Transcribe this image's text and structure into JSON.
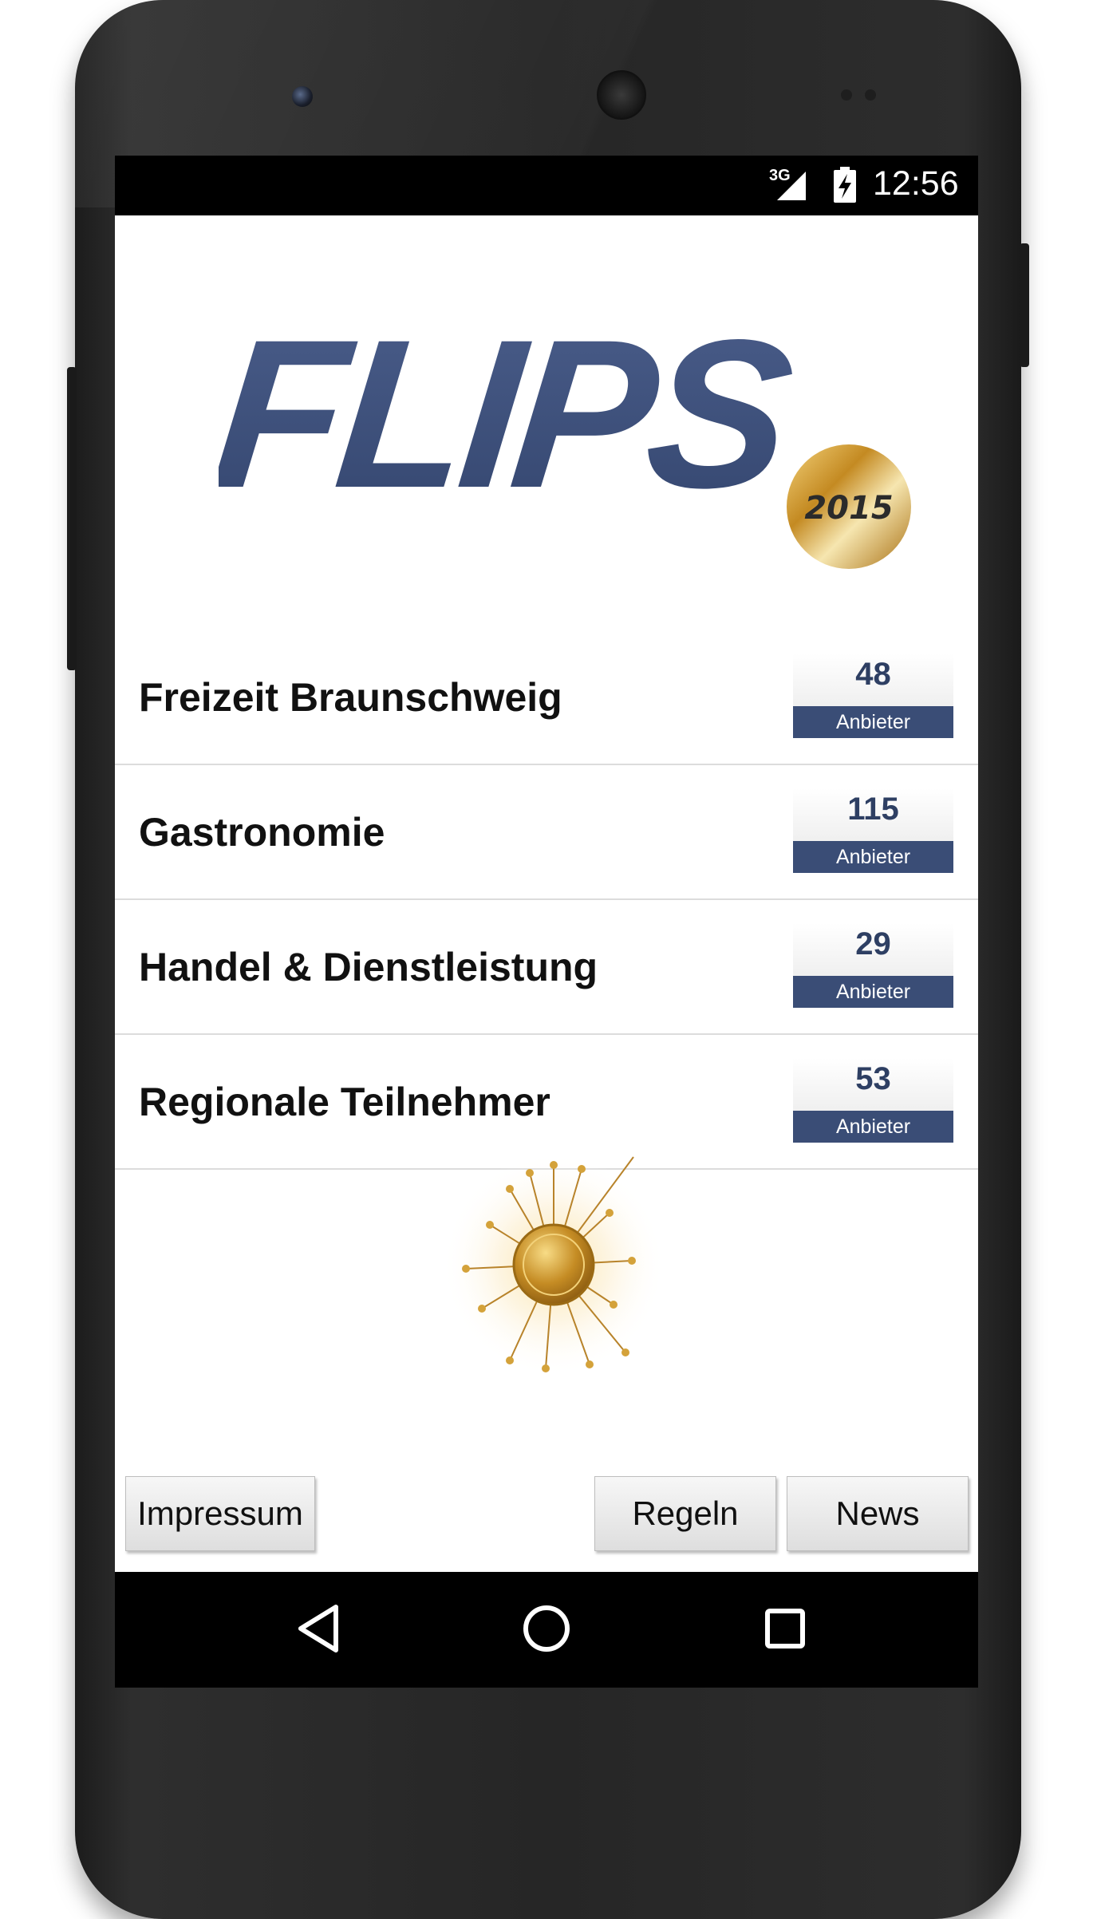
{
  "status_bar": {
    "network": "3G",
    "time": "12:56"
  },
  "logo": {
    "text": "FLIPS",
    "year": "2015",
    "brand_color": "#3d4f7c",
    "seal_color": "#c9962a"
  },
  "categories": [
    {
      "name": "Freizeit Braunschweig",
      "count": "48",
      "count_label": "Anbieter"
    },
    {
      "name": "Gastronomie",
      "count": "115",
      "count_label": "Anbieter"
    },
    {
      "name": "Handel & Dienstleistung",
      "count": "29",
      "count_label": "Anbieter"
    },
    {
      "name": "Regionale Teilnehmer",
      "count": "53",
      "count_label": "Anbieter"
    }
  ],
  "footer": {
    "impressum_label": "Impressum",
    "regeln_label": "Regeln",
    "news_label": "News"
  },
  "nav_bar": {
    "back_icon": "back-triangle-icon",
    "home_icon": "home-circle-icon",
    "recents_icon": "recents-square-icon"
  },
  "colors": {
    "accent": "#3a4d76",
    "count_text": "#2e3f63",
    "gold": "#d4a23a"
  }
}
